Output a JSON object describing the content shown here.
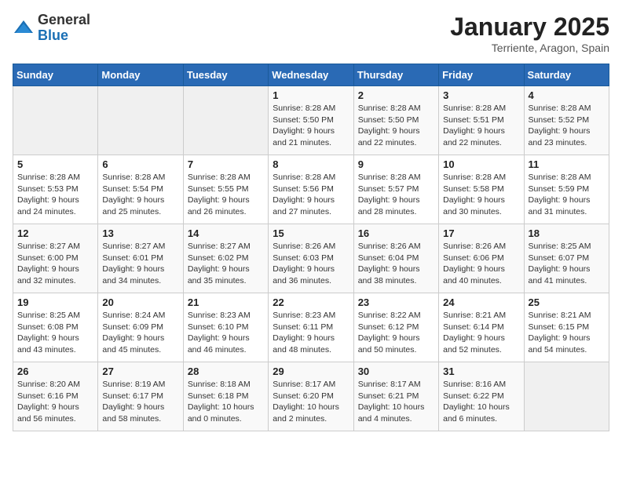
{
  "header": {
    "logo_general": "General",
    "logo_blue": "Blue",
    "month_title": "January 2025",
    "location": "Terriente, Aragon, Spain"
  },
  "weekdays": [
    "Sunday",
    "Monday",
    "Tuesday",
    "Wednesday",
    "Thursday",
    "Friday",
    "Saturday"
  ],
  "weeks": [
    [
      {
        "day": "",
        "info": ""
      },
      {
        "day": "",
        "info": ""
      },
      {
        "day": "",
        "info": ""
      },
      {
        "day": "1",
        "info": "Sunrise: 8:28 AM\nSunset: 5:50 PM\nDaylight: 9 hours and 21 minutes."
      },
      {
        "day": "2",
        "info": "Sunrise: 8:28 AM\nSunset: 5:50 PM\nDaylight: 9 hours and 22 minutes."
      },
      {
        "day": "3",
        "info": "Sunrise: 8:28 AM\nSunset: 5:51 PM\nDaylight: 9 hours and 22 minutes."
      },
      {
        "day": "4",
        "info": "Sunrise: 8:28 AM\nSunset: 5:52 PM\nDaylight: 9 hours and 23 minutes."
      }
    ],
    [
      {
        "day": "5",
        "info": "Sunrise: 8:28 AM\nSunset: 5:53 PM\nDaylight: 9 hours and 24 minutes."
      },
      {
        "day": "6",
        "info": "Sunrise: 8:28 AM\nSunset: 5:54 PM\nDaylight: 9 hours and 25 minutes."
      },
      {
        "day": "7",
        "info": "Sunrise: 8:28 AM\nSunset: 5:55 PM\nDaylight: 9 hours and 26 minutes."
      },
      {
        "day": "8",
        "info": "Sunrise: 8:28 AM\nSunset: 5:56 PM\nDaylight: 9 hours and 27 minutes."
      },
      {
        "day": "9",
        "info": "Sunrise: 8:28 AM\nSunset: 5:57 PM\nDaylight: 9 hours and 28 minutes."
      },
      {
        "day": "10",
        "info": "Sunrise: 8:28 AM\nSunset: 5:58 PM\nDaylight: 9 hours and 30 minutes."
      },
      {
        "day": "11",
        "info": "Sunrise: 8:28 AM\nSunset: 5:59 PM\nDaylight: 9 hours and 31 minutes."
      }
    ],
    [
      {
        "day": "12",
        "info": "Sunrise: 8:27 AM\nSunset: 6:00 PM\nDaylight: 9 hours and 32 minutes."
      },
      {
        "day": "13",
        "info": "Sunrise: 8:27 AM\nSunset: 6:01 PM\nDaylight: 9 hours and 34 minutes."
      },
      {
        "day": "14",
        "info": "Sunrise: 8:27 AM\nSunset: 6:02 PM\nDaylight: 9 hours and 35 minutes."
      },
      {
        "day": "15",
        "info": "Sunrise: 8:26 AM\nSunset: 6:03 PM\nDaylight: 9 hours and 36 minutes."
      },
      {
        "day": "16",
        "info": "Sunrise: 8:26 AM\nSunset: 6:04 PM\nDaylight: 9 hours and 38 minutes."
      },
      {
        "day": "17",
        "info": "Sunrise: 8:26 AM\nSunset: 6:06 PM\nDaylight: 9 hours and 40 minutes."
      },
      {
        "day": "18",
        "info": "Sunrise: 8:25 AM\nSunset: 6:07 PM\nDaylight: 9 hours and 41 minutes."
      }
    ],
    [
      {
        "day": "19",
        "info": "Sunrise: 8:25 AM\nSunset: 6:08 PM\nDaylight: 9 hours and 43 minutes."
      },
      {
        "day": "20",
        "info": "Sunrise: 8:24 AM\nSunset: 6:09 PM\nDaylight: 9 hours and 45 minutes."
      },
      {
        "day": "21",
        "info": "Sunrise: 8:23 AM\nSunset: 6:10 PM\nDaylight: 9 hours and 46 minutes."
      },
      {
        "day": "22",
        "info": "Sunrise: 8:23 AM\nSunset: 6:11 PM\nDaylight: 9 hours and 48 minutes."
      },
      {
        "day": "23",
        "info": "Sunrise: 8:22 AM\nSunset: 6:12 PM\nDaylight: 9 hours and 50 minutes."
      },
      {
        "day": "24",
        "info": "Sunrise: 8:21 AM\nSunset: 6:14 PM\nDaylight: 9 hours and 52 minutes."
      },
      {
        "day": "25",
        "info": "Sunrise: 8:21 AM\nSunset: 6:15 PM\nDaylight: 9 hours and 54 minutes."
      }
    ],
    [
      {
        "day": "26",
        "info": "Sunrise: 8:20 AM\nSunset: 6:16 PM\nDaylight: 9 hours and 56 minutes."
      },
      {
        "day": "27",
        "info": "Sunrise: 8:19 AM\nSunset: 6:17 PM\nDaylight: 9 hours and 58 minutes."
      },
      {
        "day": "28",
        "info": "Sunrise: 8:18 AM\nSunset: 6:18 PM\nDaylight: 10 hours and 0 minutes."
      },
      {
        "day": "29",
        "info": "Sunrise: 8:17 AM\nSunset: 6:20 PM\nDaylight: 10 hours and 2 minutes."
      },
      {
        "day": "30",
        "info": "Sunrise: 8:17 AM\nSunset: 6:21 PM\nDaylight: 10 hours and 4 minutes."
      },
      {
        "day": "31",
        "info": "Sunrise: 8:16 AM\nSunset: 6:22 PM\nDaylight: 10 hours and 6 minutes."
      },
      {
        "day": "",
        "info": ""
      }
    ]
  ]
}
